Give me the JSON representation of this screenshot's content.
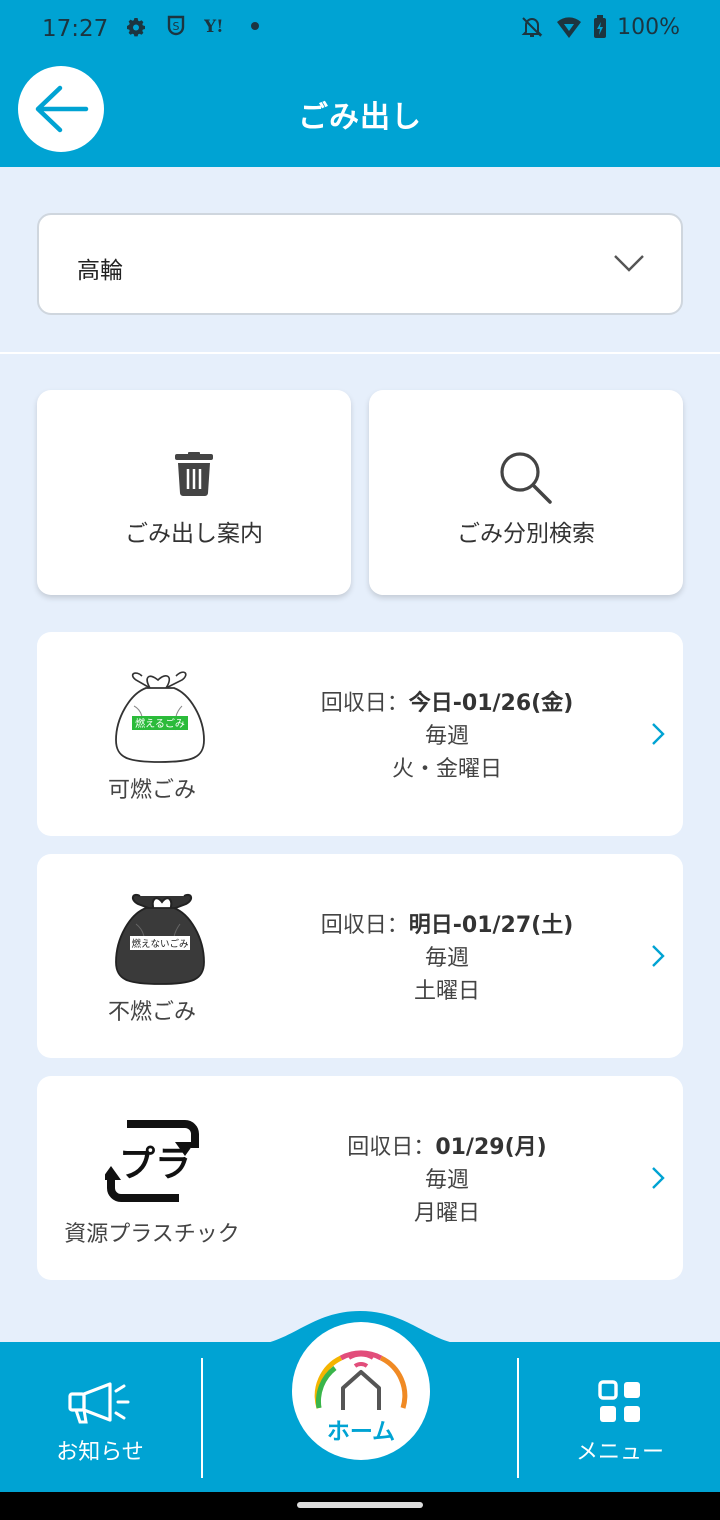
{
  "status_bar": {
    "time": "17:27",
    "left_icons": [
      "gear-icon",
      "shield-icon",
      "yahoo-icon",
      "dot-icon"
    ],
    "battery": "100%",
    "right_icons": [
      "bell-off-icon",
      "wifi-icon",
      "battery-icon"
    ]
  },
  "app_bar": {
    "title": "ごみ出し",
    "back_icon": "arrow-left-icon"
  },
  "area_select": {
    "value": "高輪",
    "icon": "chevron-down-icon"
  },
  "tiles": [
    {
      "label": "ごみ出し案内",
      "icon": "trash-icon"
    },
    {
      "label": "ごみ分別検索",
      "icon": "search-icon"
    }
  ],
  "schedules": [
    {
      "name": "可燃ごみ",
      "icon": "burnable-bag-icon",
      "bag_text": "燃えるごみ",
      "prefix": "回収日：",
      "date": "今日-01/26(金)",
      "frequency": "毎週",
      "days": "火・金曜日"
    },
    {
      "name": "不燃ごみ",
      "icon": "nonburnable-bag-icon",
      "bag_text": "燃えないごみ",
      "prefix": "回収日：",
      "date": "明日-01/27(土)",
      "frequency": "毎週",
      "days": "土曜日"
    },
    {
      "name": "資源プラスチック",
      "icon": "plastic-recycle-icon",
      "bag_text": "プラ",
      "prefix": "回収日：",
      "date": "01/29(月)",
      "frequency": "毎週",
      "days": "月曜日"
    }
  ],
  "bottom_nav": {
    "news_label": "お知らせ",
    "home_label": "ホーム",
    "menu_label": "メニュー"
  },
  "colors": {
    "primary": "#00a3d3",
    "background": "#e6effb"
  }
}
